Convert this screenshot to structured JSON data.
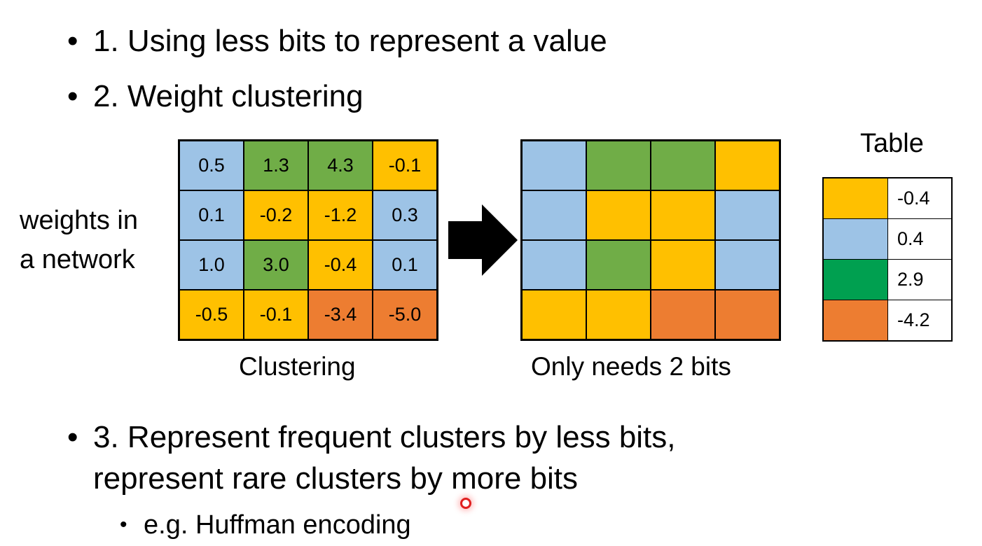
{
  "bullets": {
    "b1": "1. Using less bits to represent a value",
    "b2": "2. Weight clustering",
    "b3_line1": "3. Represent frequent clusters by less bits,",
    "b3_line2": "represent rare clusters by more bits",
    "sub1": "e.g. Huffman encoding"
  },
  "left_label": {
    "line1": "weights in",
    "line2": "a network"
  },
  "colors": {
    "blue": "#9dc3e6",
    "green": "#70ad47",
    "yellow": "#ffc000",
    "orange": "#ed7d31",
    "table_green": "#00a050"
  },
  "weights": [
    [
      "0.5",
      "1.3",
      "4.3",
      "-0.1"
    ],
    [
      "0.1",
      "-0.2",
      "-1.2",
      "0.3"
    ],
    [
      "1.0",
      "3.0",
      "-0.4",
      "0.1"
    ],
    [
      "-0.5",
      "-0.1",
      "-3.4",
      "-5.0"
    ]
  ],
  "cluster_grid": [
    [
      "blue",
      "green",
      "green",
      "yellow"
    ],
    [
      "blue",
      "yellow",
      "yellow",
      "blue"
    ],
    [
      "blue",
      "green",
      "yellow",
      "blue"
    ],
    [
      "yellow",
      "yellow",
      "orange",
      "orange"
    ]
  ],
  "captions": {
    "left": "Clustering",
    "right": "Only needs 2 bits"
  },
  "table": {
    "title": "Table",
    "rows": [
      {
        "color": "yellow",
        "value": "-0.4"
      },
      {
        "color": "blue",
        "value": "0.4"
      },
      {
        "color": "table_green",
        "value": "2.9"
      },
      {
        "color": "orange",
        "value": "-4.2"
      }
    ]
  },
  "icons": {
    "arrow": "right-arrow-icon",
    "cursor": "cursor-dot-icon"
  }
}
